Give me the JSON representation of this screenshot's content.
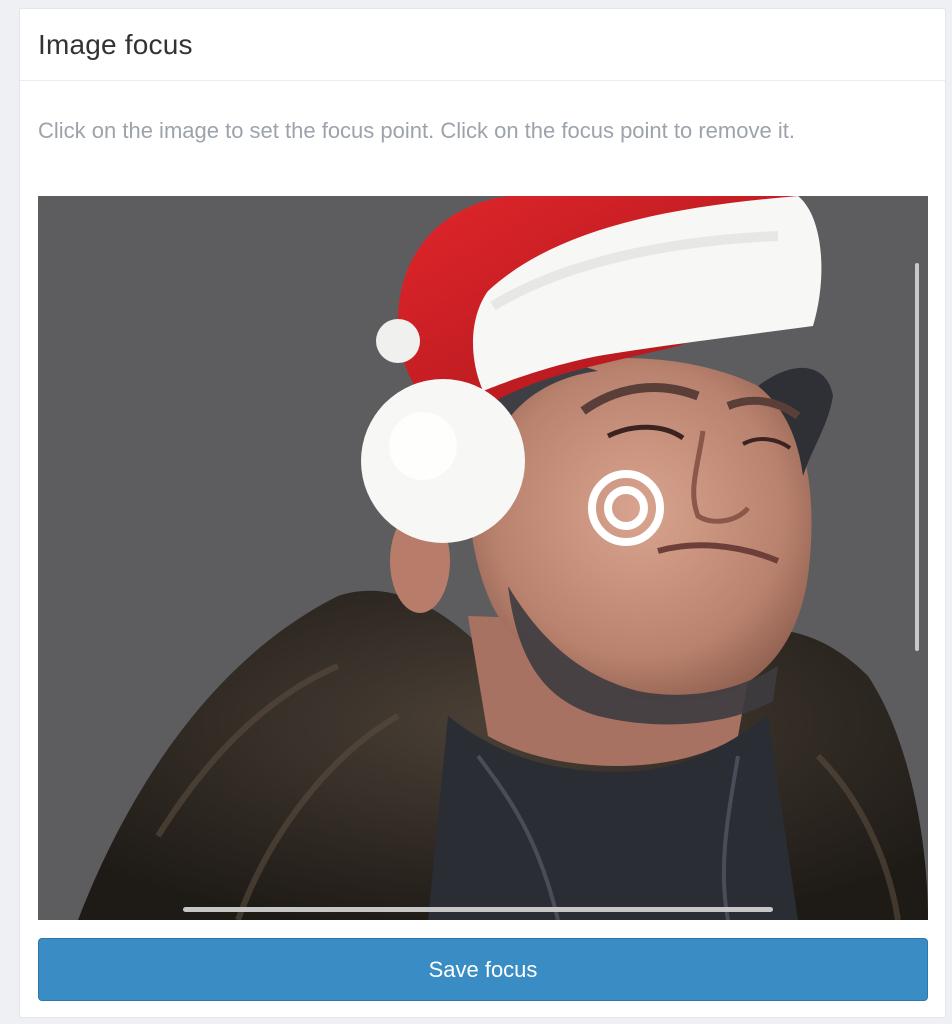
{
  "panel": {
    "title": "Image focus",
    "help_text": "Click on the image to set the focus point. Click on the focus point to remove it."
  },
  "image": {
    "background_color": "#5d5d5f",
    "subject": "illustrated portrait wearing a red and white santa hat and a dark fur collar"
  },
  "focus_point": {
    "icon": "target-icon",
    "color": "#ffffff"
  },
  "actions": {
    "save_label": "Save focus",
    "save_color": "#3a8cc4"
  }
}
